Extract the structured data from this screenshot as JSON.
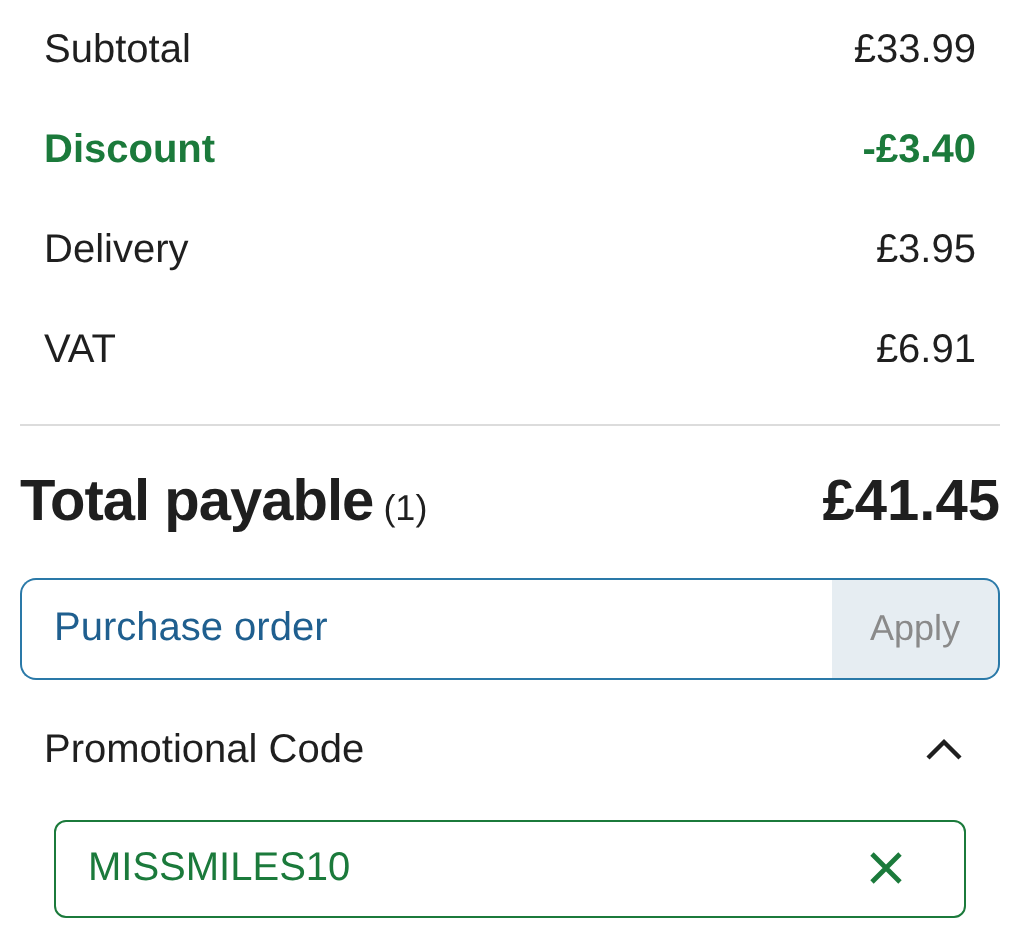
{
  "summary": [
    {
      "label": "Subtotal",
      "amount": "£33.99",
      "kind": "normal"
    },
    {
      "label": "Discount",
      "amount": "-£3.40",
      "kind": "discount"
    },
    {
      "label": "Delivery",
      "amount": "£3.95",
      "kind": "normal"
    },
    {
      "label": "VAT",
      "amount": "£6.91",
      "kind": "normal"
    }
  ],
  "total": {
    "label": "Total payable",
    "count": "(1)",
    "amount": "£41.45"
  },
  "purchase_order": {
    "placeholder": "Purchase order",
    "button": "Apply",
    "disabled": true
  },
  "promo": {
    "title": "Promotional Code",
    "expanded": true,
    "value": "MISSMILES10"
  }
}
